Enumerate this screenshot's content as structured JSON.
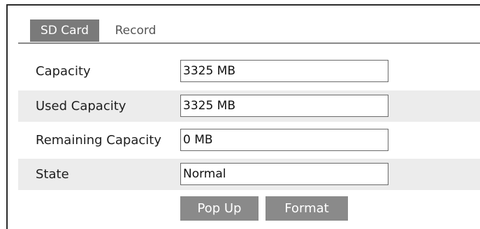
{
  "tabs": [
    {
      "label": "SD Card",
      "active": true
    },
    {
      "label": "Record",
      "active": false
    }
  ],
  "fields": [
    {
      "label": "Capacity",
      "value": "3325 MB"
    },
    {
      "label": "Used Capacity",
      "value": "3325 MB"
    },
    {
      "label": "Remaining Capacity",
      "value": "0 MB"
    },
    {
      "label": "State",
      "value": "Normal"
    }
  ],
  "buttons": {
    "pop_up": "Pop Up",
    "format": "Format"
  }
}
